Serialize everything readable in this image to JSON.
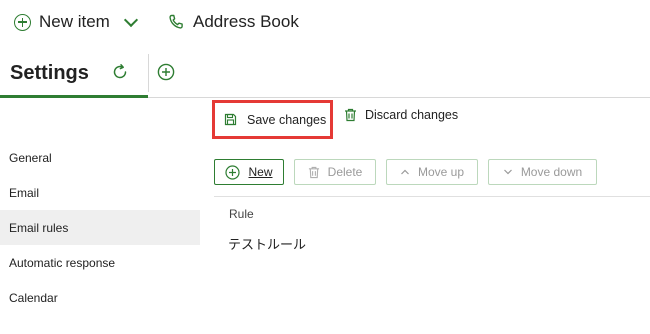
{
  "topbar": {
    "new_item_label": "New item",
    "address_book_label": "Address Book"
  },
  "settings": {
    "title": "Settings"
  },
  "actions": {
    "save_label": "Save changes",
    "discard_label": "Discard changes"
  },
  "sidebar": {
    "items": [
      {
        "label": "General"
      },
      {
        "label": "Email"
      },
      {
        "label": "Email rules",
        "active": true
      },
      {
        "label": "Automatic response"
      },
      {
        "label": "Calendar"
      }
    ]
  },
  "rules_toolbar": {
    "new_label": "New",
    "delete_label": "Delete",
    "move_up_label": "Move up",
    "move_down_label": "Move down"
  },
  "rules_table": {
    "column_header": "Rule",
    "rows": [
      {
        "name": "テストルール"
      }
    ]
  },
  "colors": {
    "accent": "#2e7d32",
    "highlight_border": "#e53935",
    "active_item_bg": "#efefef"
  }
}
